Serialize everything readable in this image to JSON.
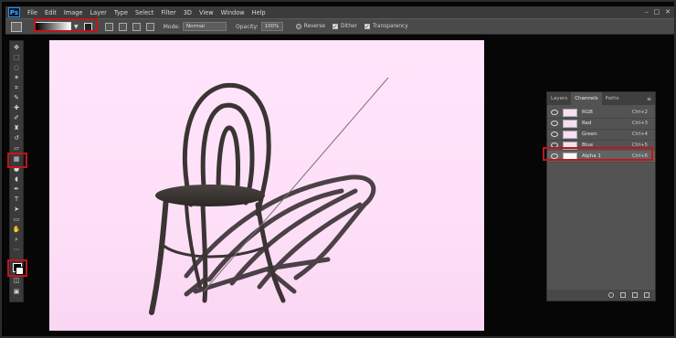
{
  "app": {
    "logo": "Ps"
  },
  "menu": [
    "File",
    "Edit",
    "Image",
    "Layer",
    "Type",
    "Select",
    "Filter",
    "3D",
    "View",
    "Window",
    "Help"
  ],
  "window_controls": [
    "–",
    "□",
    "✕"
  ],
  "options": {
    "mode_label": "Mode:",
    "mode_value": "Normal",
    "opacity_label": "Opacity:",
    "opacity_value": "100%",
    "reverse_label": "Reverse",
    "dither_label": "Dither",
    "transparency_label": "Transparency",
    "reverse_checked": false,
    "dither_checked": true,
    "transparency_checked": true
  },
  "toolbar": {
    "tool_icons": [
      "move-icon",
      "marquee-icon",
      "lasso-icon",
      "magic-wand-icon",
      "crop-icon",
      "eyedropper-icon",
      "healing-brush-icon",
      "brush-icon",
      "clone-stamp-icon",
      "history-brush-icon",
      "eraser-icon",
      "gradient-icon",
      "blur-icon",
      "dodge-icon",
      "pen-icon",
      "type-icon",
      "path-selection-icon",
      "shape-icon",
      "hand-icon",
      "zoom-icon",
      "more-tools-icon"
    ],
    "colors": {
      "foreground": "#000000",
      "background": "#ffffff"
    }
  },
  "panels": {
    "tabs": [
      "Layers",
      "Channels",
      "Paths"
    ],
    "active_tab": "Channels",
    "channels": [
      {
        "name": "RGB",
        "shortcut": "Ctrl+2"
      },
      {
        "name": "Red",
        "shortcut": "Ctrl+3"
      },
      {
        "name": "Green",
        "shortcut": "Ctrl+4"
      },
      {
        "name": "Blue",
        "shortcut": "Ctrl+5"
      },
      {
        "name": "Alpha 1",
        "shortcut": "Ctrl+6"
      }
    ],
    "selected_channel": "Alpha 1"
  },
  "colors": {
    "highlight": "#c0151b",
    "canvas_top": "#ffe4fb",
    "canvas_bottom": "#fad6f3"
  }
}
